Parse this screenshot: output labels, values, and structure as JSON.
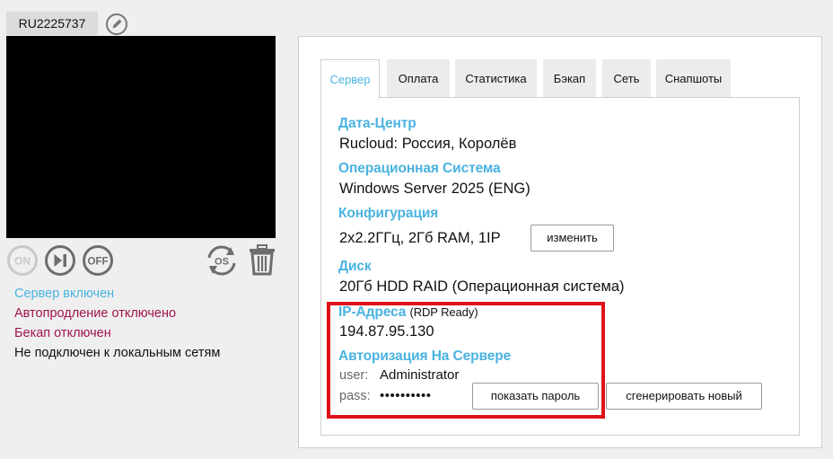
{
  "server": {
    "id": "RU2225737",
    "controls": {
      "on": "ON",
      "off": "OFF",
      "os": "OS"
    }
  },
  "status": [
    {
      "text": "Сервер включен",
      "color": "#4ab3e0"
    },
    {
      "text": "Автопродление отключено",
      "color": "#a0144f"
    },
    {
      "text": "Бекап отключен",
      "color": "#a0144f"
    },
    {
      "text": "Не подключен к локальным сетям",
      "color": "#111111"
    }
  ],
  "tabs": [
    {
      "label": "Сервер",
      "active": true
    },
    {
      "label": "Оплата",
      "active": false
    },
    {
      "label": "Статистика",
      "active": false
    },
    {
      "label": "Бэкап",
      "active": false
    },
    {
      "label": "Сеть",
      "active": false
    },
    {
      "label": "Снапшоты",
      "active": false
    }
  ],
  "info": {
    "datacenter_label": "Дата-Центр",
    "datacenter_value": "Rucloud: Россия, Королёв",
    "os_label": "Операционная Система",
    "os_value": "Windows Server 2025 (ENG)",
    "config_label": "Конфигурация",
    "config_value": "2x2.2ГГц, 2Гб RAM, 1IP",
    "config_button": "изменить",
    "disk_label": "Диск",
    "disk_value": "20Гб HDD RAID (Операционная система)",
    "ip_label": "IP-Адреса",
    "ip_note": "(RDP Ready)",
    "ip_value": "194.87.95.130",
    "auth_label": "Авторизация На Сервере",
    "user_key": "user:",
    "user_value": "Administrator",
    "pass_key": "pass:",
    "pass_value": "••••••••••",
    "show_password_button": "показать пароль",
    "generate_button": "сгенерировать новый"
  },
  "colors": {
    "accent": "#4ab3e0",
    "warning": "#a0144f",
    "highlight_box": "#e0101b"
  }
}
